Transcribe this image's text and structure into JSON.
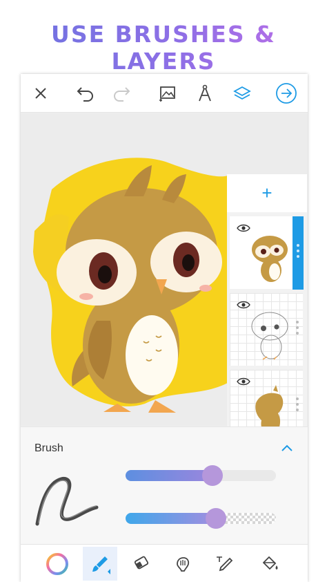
{
  "headline": "USE BRUSHES & LAYERS",
  "toolbar": {
    "icons": [
      "close-icon",
      "undo-icon",
      "redo-icon",
      "add-image-icon",
      "compass-icon",
      "layers-icon",
      "next-arrow-icon"
    ]
  },
  "layers": {
    "add_label": "+",
    "items": [
      {
        "name": "layer-full-color",
        "selected": true
      },
      {
        "name": "layer-sketch",
        "selected": false
      },
      {
        "name": "layer-silhouette",
        "selected": false
      }
    ]
  },
  "brush_panel": {
    "title": "Brush",
    "size_level": 0.58,
    "opacity_level": 0.6
  },
  "bottom_tools": {
    "items": [
      "color-wheel-icon",
      "brush-icon",
      "eraser-icon",
      "smudge-icon",
      "text-icon",
      "fill-bucket-icon"
    ],
    "active": "brush-icon"
  },
  "colors": {
    "accent": "#1e9be5",
    "thumb": "#b597db",
    "canvas_yellow": "#f7d21c",
    "owl_brown": "#c59a45"
  }
}
